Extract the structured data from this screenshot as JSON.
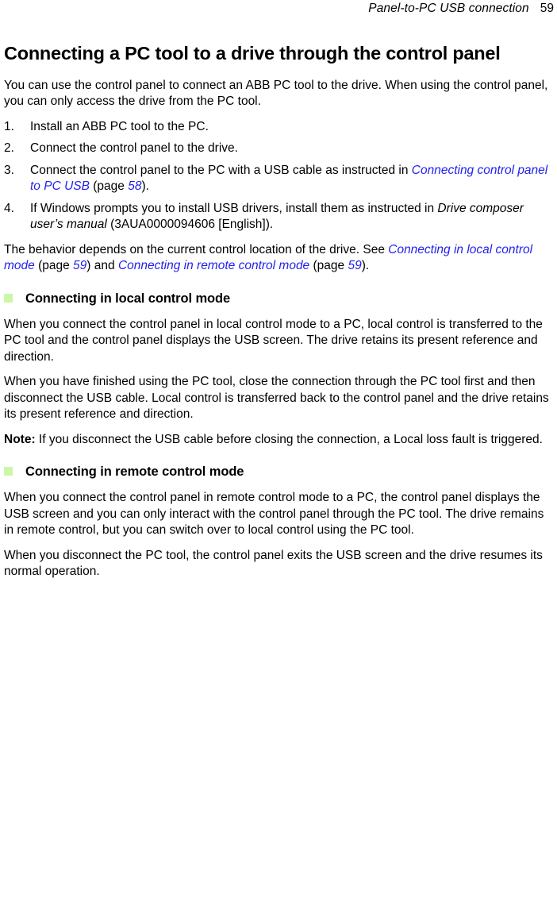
{
  "header": {
    "title": "Panel-to-PC USB connection",
    "page_number": "59"
  },
  "colors": {
    "link": "#2222ee",
    "bullet_green": "#ccf7a8",
    "text": "#000000"
  },
  "main": {
    "title": "Connecting a PC tool to a drive through the control panel",
    "intro": "You can use the control panel to connect an ABB PC tool to the drive. When using the control panel, you can only access the drive from the PC tool.",
    "steps": [
      {
        "num": "1.",
        "parts": [
          {
            "text": "Install an ABB PC tool to the PC.",
            "style": "plain"
          }
        ]
      },
      {
        "num": "2.",
        "parts": [
          {
            "text": "Connect the control panel to the drive.",
            "style": "plain"
          }
        ]
      },
      {
        "num": "3.",
        "parts": [
          {
            "text": "Connect the control panel to the PC with a USB cable as instructed in ",
            "style": "plain"
          },
          {
            "text": "Connecting control panel to PC USB",
            "style": "link"
          },
          {
            "text": " (page ",
            "style": "plain"
          },
          {
            "text": "58",
            "style": "link"
          },
          {
            "text": ").",
            "style": "plain"
          }
        ]
      },
      {
        "num": "4.",
        "parts": [
          {
            "text": "If Windows prompts you to install USB drivers, install them as instructed in ",
            "style": "plain"
          },
          {
            "text": "Drive composer user’s manual",
            "style": "italic"
          },
          {
            "text": " (3AUA0000094606 [English]).",
            "style": "plain"
          }
        ]
      }
    ],
    "behavior_paragraph": [
      {
        "text": "The behavior depends on the current control location of the drive. See ",
        "style": "plain"
      },
      {
        "text": "Connecting in local control mode",
        "style": "link"
      },
      {
        "text": " (page ",
        "style": "plain"
      },
      {
        "text": "59",
        "style": "link"
      },
      {
        "text": ") and ",
        "style": "plain"
      },
      {
        "text": "Connecting in remote control mode",
        "style": "link"
      },
      {
        "text": " (page ",
        "style": "plain"
      },
      {
        "text": "59",
        "style": "link"
      },
      {
        "text": ").",
        "style": "plain"
      }
    ],
    "sections": [
      {
        "heading": "Connecting in local control mode",
        "paragraphs": [
          [
            {
              "text": "When you connect the control panel in local control mode to a PC, local control is transferred to the PC tool and the control panel displays the USB screen. The drive retains its present reference and direction.",
              "style": "plain"
            }
          ],
          [
            {
              "text": "When you have finished using the PC tool, close the connection through the PC tool first and then disconnect the USB cable. Local control is transferred back to the control panel and the drive retains its present reference and direction.",
              "style": "plain"
            }
          ],
          [
            {
              "text": "Note:",
              "style": "bold"
            },
            {
              "text": " If you disconnect the USB cable before closing the connection, a Local loss fault is triggered.",
              "style": "plain"
            }
          ]
        ]
      },
      {
        "heading": "Connecting in remote control mode",
        "paragraphs": [
          [
            {
              "text": "When you connect the control panel in remote control mode to a PC, the control panel displays the USB screen and you can only interact with the control panel through the PC tool. The drive remains in remote control, but you can switch over to local control using the PC tool.",
              "style": "plain"
            }
          ],
          [
            {
              "text": "When you disconnect the PC tool, the control panel exits the USB screen and the drive resumes its normal operation.",
              "style": "plain"
            }
          ]
        ]
      }
    ]
  }
}
